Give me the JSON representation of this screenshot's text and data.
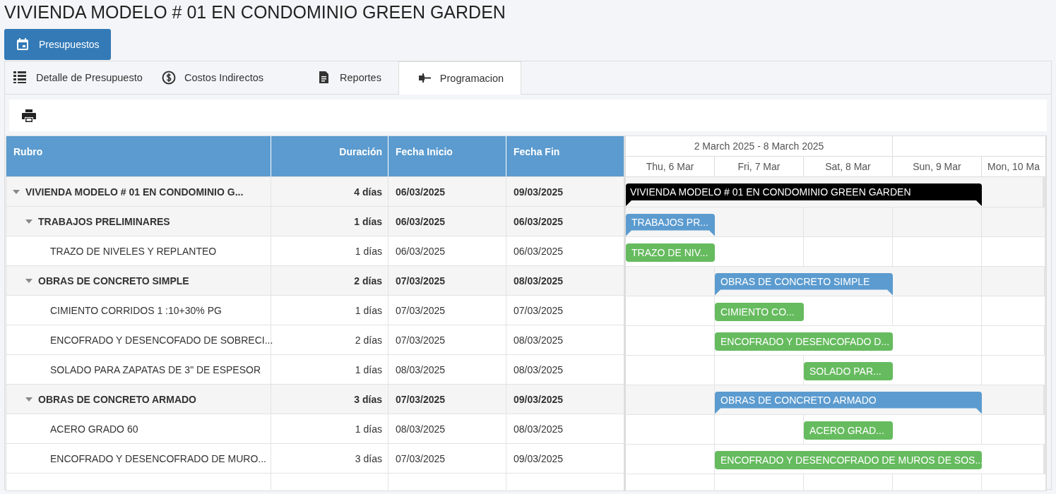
{
  "page_title": "VIVIENDA MODELO # 01 EN CONDOMINIO GREEN GARDEN",
  "main_button": {
    "label": "Presupuestos"
  },
  "tabs": [
    {
      "label": "Detalle de Presupuesto",
      "kind": "list",
      "selected": false
    },
    {
      "label": "Costos Indirectos",
      "kind": "dollar",
      "selected": false
    },
    {
      "label": "Reportes",
      "kind": "document",
      "selected": false
    },
    {
      "label": "Programacion",
      "kind": "schedule",
      "selected": true
    }
  ],
  "table": {
    "columns": [
      "Rubro",
      "Duración",
      "Fecha Inicio",
      "Fecha Fin"
    ],
    "rows": [
      {
        "kind": "project",
        "expanded": true,
        "name": "VIVIENDA MODELO # 01 EN CONDOMINIO G...",
        "duration": "4 días",
        "start": "06/03/2025",
        "end": "09/03/2025",
        "bar_label": "VIVIENDA MODELO # 01 EN CONDOMINIO GREEN GARDEN",
        "children": [
          {
            "kind": "summary",
            "expanded": true,
            "name": "TRABAJOS PRELIMINARES",
            "duration": "1 días",
            "start": "06/03/2025",
            "end": "06/03/2025",
            "bar_label": "TRABAJOS PR...",
            "children": [
              {
                "kind": "task",
                "name": "TRAZO DE NIVELES Y REPLANTEO",
                "duration": "1 días",
                "start": "06/03/2025",
                "end": "06/03/2025",
                "bar_label": "TRAZO DE NIV..."
              }
            ]
          },
          {
            "kind": "summary",
            "expanded": true,
            "name": "OBRAS DE CONCRETO SIMPLE",
            "duration": "2 días",
            "start": "07/03/2025",
            "end": "08/03/2025",
            "bar_label": "OBRAS DE CONCRETO SIMPLE",
            "children": [
              {
                "kind": "task",
                "name": "CIMIENTO CORRIDOS 1 :10+30% PG",
                "duration": "1 días",
                "start": "07/03/2025",
                "end": "07/03/2025",
                "bar_label": "CIMIENTO CO..."
              },
              {
                "kind": "task",
                "name": "ENCOFRADO Y DESENCOFADO DE SOBRECI...",
                "duration": "2 días",
                "start": "07/03/2025",
                "end": "08/03/2025",
                "bar_label": "ENCOFRADO Y DESENCOFADO D..."
              },
              {
                "kind": "task",
                "name": "SOLADO PARA ZAPATAS DE 3\" DE ESPESOR",
                "duration": "1 días",
                "start": "08/03/2025",
                "end": "08/03/2025",
                "bar_label": "SOLADO PAR..."
              }
            ]
          },
          {
            "kind": "summary",
            "expanded": true,
            "name": "OBRAS DE CONCRETO ARMADO",
            "duration": "3 días",
            "start": "07/03/2025",
            "end": "09/03/2025",
            "bar_label": "OBRAS DE CONCRETO ARMADO",
            "children": [
              {
                "kind": "task",
                "name": "ACERO GRADO 60",
                "duration": "1 días",
                "start": "08/03/2025",
                "end": "08/03/2025",
                "bar_label": "ACERO GRAD..."
              },
              {
                "kind": "task",
                "name": "ENCOFRADO Y DESENCOFRADO DE MURO...",
                "duration": "3 días",
                "start": "07/03/2025",
                "end": "09/03/2025",
                "bar_label": "ENCOFRADO Y DESENCOFRADO DE MUROS DE SOS..."
              }
            ]
          }
        ]
      }
    ]
  },
  "timeline": {
    "weeks": [
      {
        "label": "2 March 2025 - 8 March 2025",
        "days": [
          "Thu, 6 Mar",
          "Fri, 7 Mar",
          "Sat, 8 Mar"
        ]
      },
      {
        "days": [
          "Sun, 9 Mar",
          "Mon, 10 Ma"
        ]
      }
    ]
  }
}
